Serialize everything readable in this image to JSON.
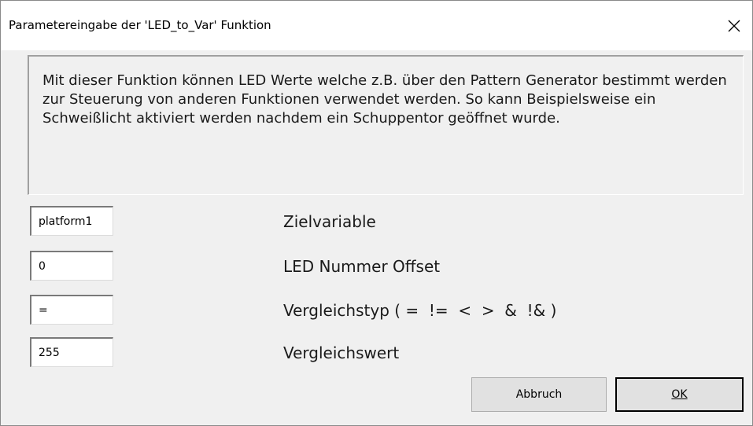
{
  "window": {
    "title": "Parametereingabe der 'LED_to_Var' Funktion",
    "close_symbol": "✕"
  },
  "description": "Mit dieser Funktion können LED Werte welche z.B. über den Pattern Generator bestimmt werden zur Steuerung von anderen Funktionen verwendet werden. So kann Beispielsweise ein Schweißlicht aktiviert werden nachdem ein Schuppentor geöffnet wurde.",
  "fields": [
    {
      "value": "platform1",
      "label": "Zielvariable"
    },
    {
      "value": "0",
      "label": "LED Nummer Offset"
    },
    {
      "value": "=",
      "label": "Vergleichstyp ( =  !=  <  >  &  !& )"
    },
    {
      "value": "255",
      "label": "Vergleichswert"
    }
  ],
  "buttons": {
    "cancel": "Abbruch",
    "ok": "OK"
  }
}
